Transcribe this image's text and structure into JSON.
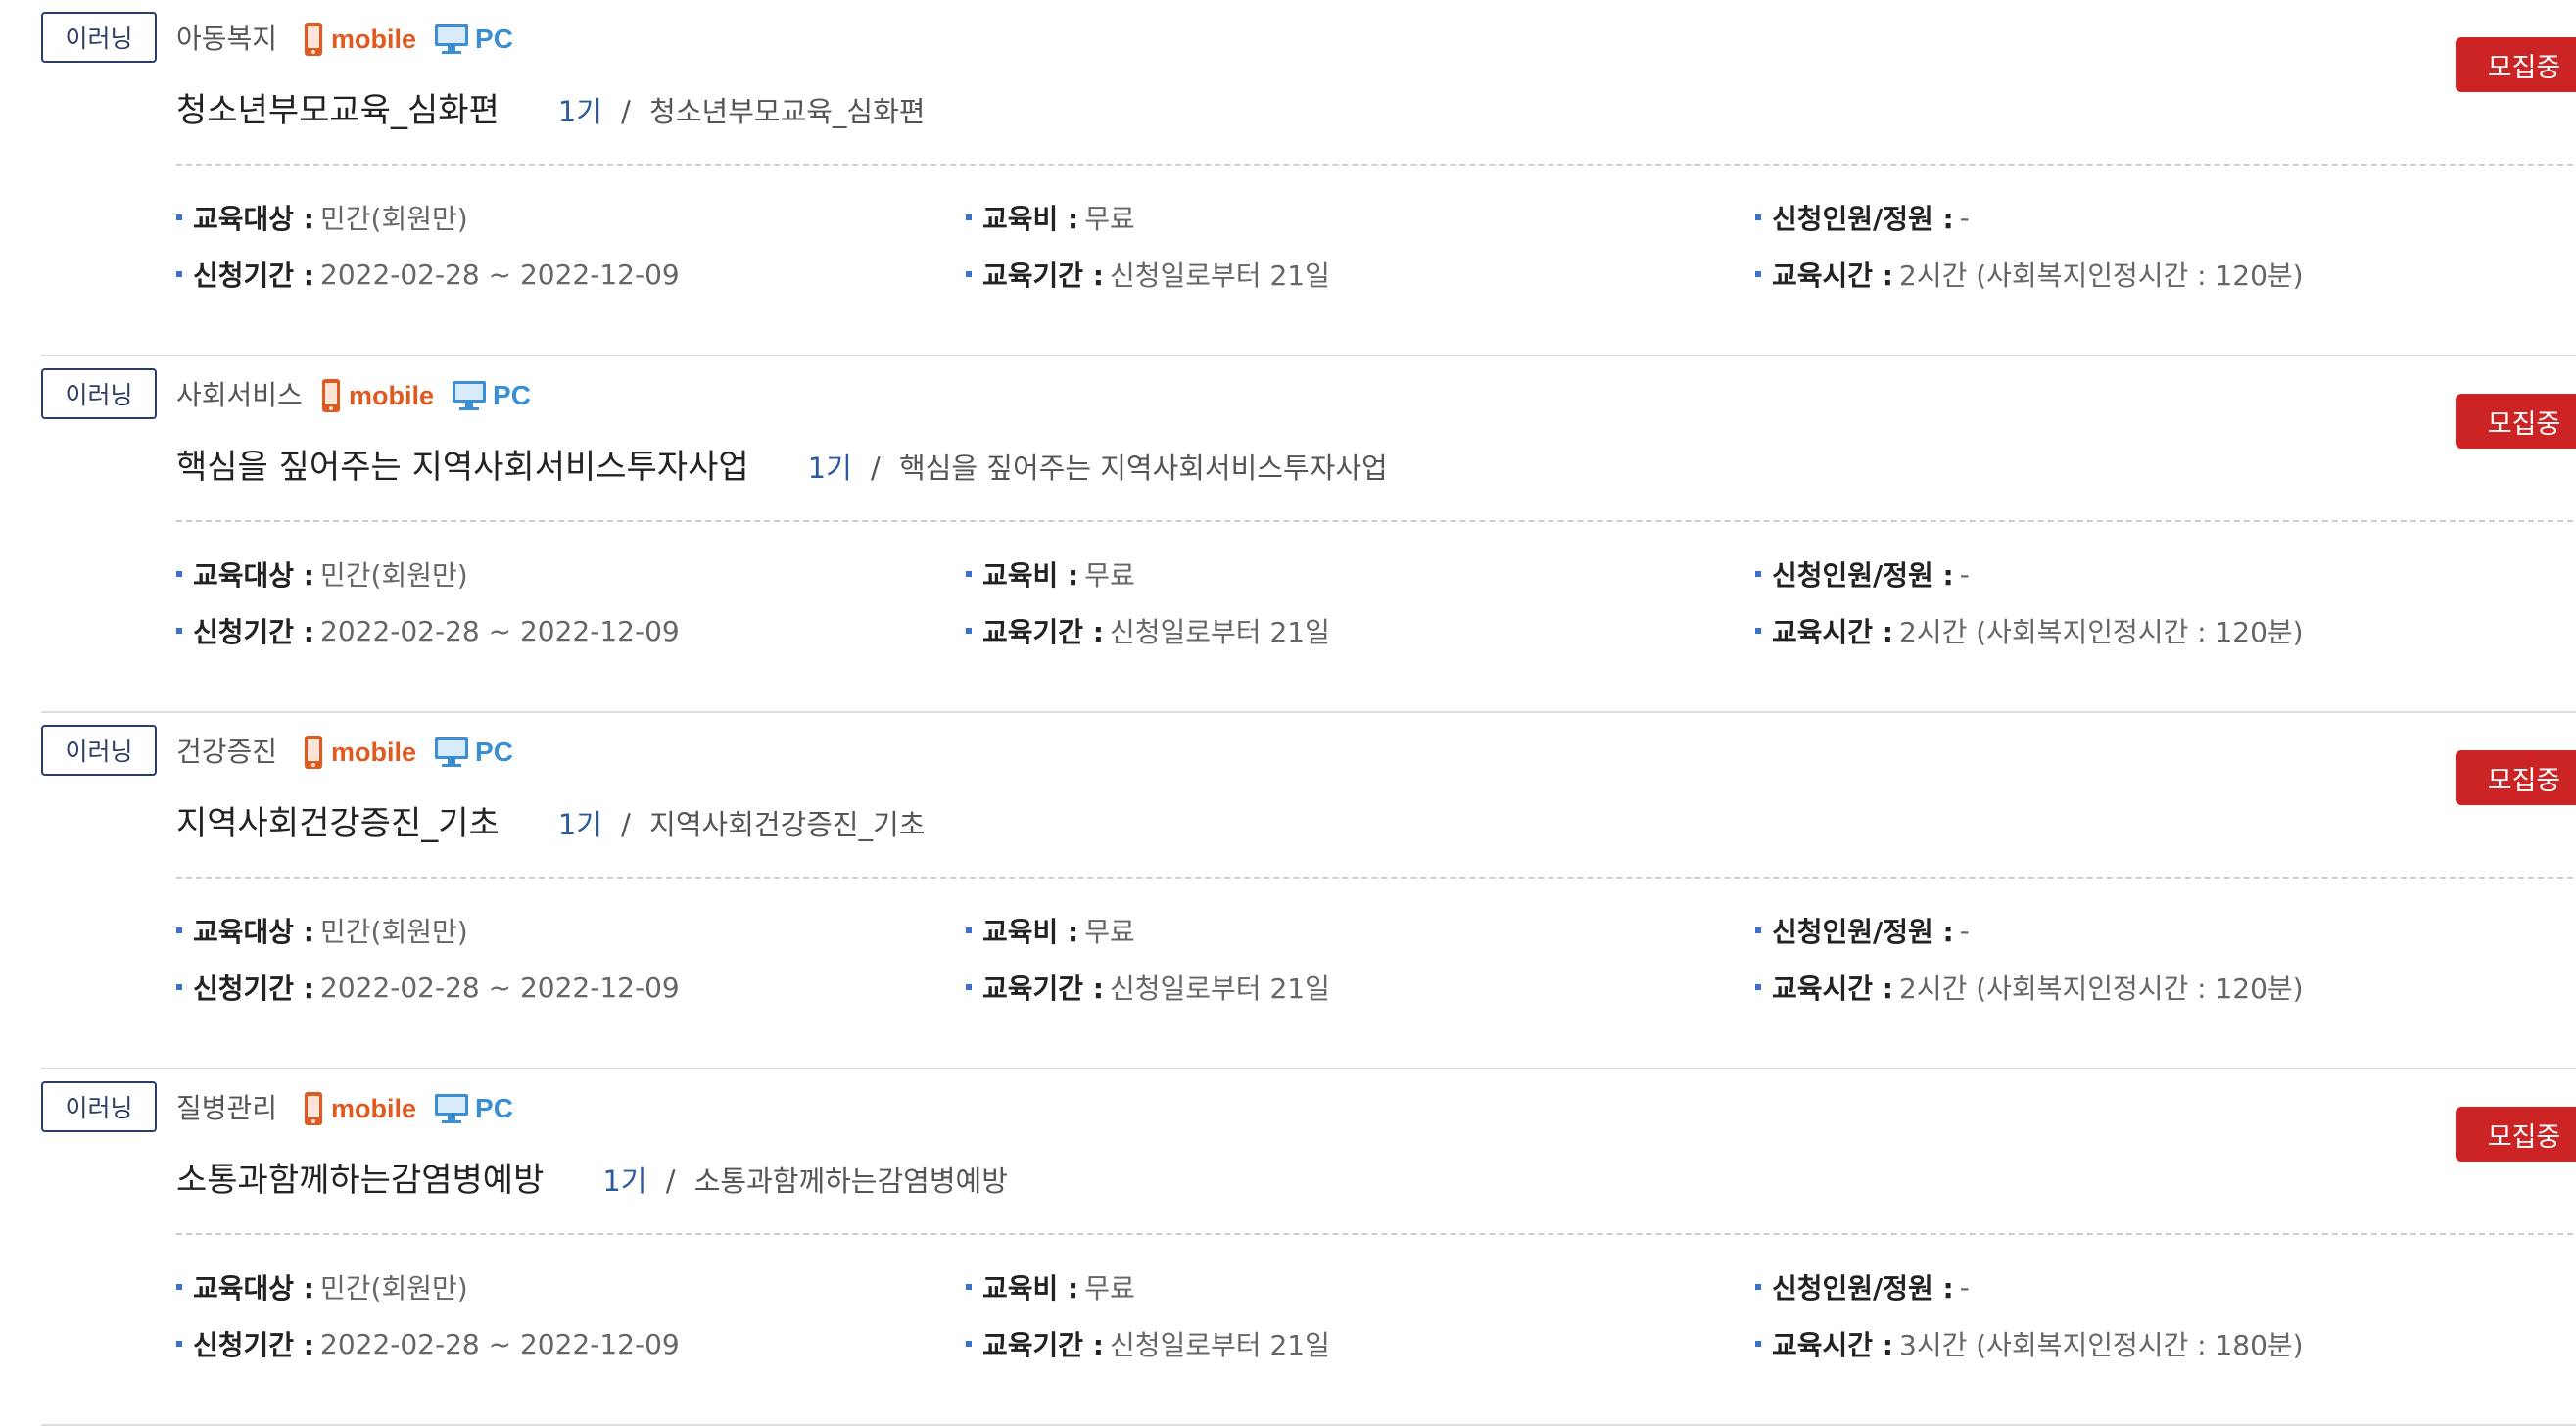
{
  "colors": {
    "navy": "#2c3e66",
    "status_red": "#cc2424",
    "mobile_orange": "#e05a1f",
    "pc_blue": "#3a8fd4",
    "bullet_blue": "#3b6fd1"
  },
  "labels": {
    "target": "교육대상 :",
    "fee": "교육비 :",
    "applicants": "신청인원/정원 :",
    "period": "신청기간 :",
    "duration": "교육기간 :",
    "hours": "교육시간 :",
    "mobile": "mobile",
    "pc": "PC",
    "slash": "/"
  },
  "icons": {
    "mobile": "mobile-phone-icon",
    "pc": "desktop-monitor-icon"
  },
  "courses": [
    {
      "type": "이러닝",
      "category": "아동복지",
      "title": "청소년부모교육_심화편",
      "term": "1기",
      "term_title": "청소년부모교육_심화편",
      "status": "모집중",
      "target": "민간(회원만)",
      "fee": "무료",
      "applicants": "-",
      "period": "2022-02-28 ~ 2022-12-09",
      "duration": "신청일로부터 21일",
      "hours": "2시간 (사회복지인정시간 : 120분)"
    },
    {
      "type": "이러닝",
      "category": "사회서비스",
      "title": "핵심을 짚어주는 지역사회서비스투자사업",
      "term": "1기",
      "term_title": "핵심을 짚어주는 지역사회서비스투자사업",
      "status": "모집중",
      "target": "민간(회원만)",
      "fee": "무료",
      "applicants": "-",
      "period": "2022-02-28 ~ 2022-12-09",
      "duration": "신청일로부터 21일",
      "hours": "2시간 (사회복지인정시간 : 120분)"
    },
    {
      "type": "이러닝",
      "category": "건강증진",
      "title": "지역사회건강증진_기초",
      "term": "1기",
      "term_title": "지역사회건강증진_기초",
      "status": "모집중",
      "target": "민간(회원만)",
      "fee": "무료",
      "applicants": "-",
      "period": "2022-02-28 ~ 2022-12-09",
      "duration": "신청일로부터 21일",
      "hours": "2시간 (사회복지인정시간 : 120분)"
    },
    {
      "type": "이러닝",
      "category": "질병관리",
      "title": "소통과함께하는감염병예방",
      "term": "1기",
      "term_title": "소통과함께하는감염병예방",
      "status": "모집중",
      "target": "민간(회원만)",
      "fee": "무료",
      "applicants": "-",
      "period": "2022-02-28 ~ 2022-12-09",
      "duration": "신청일로부터 21일",
      "hours": "3시간 (사회복지인정시간 : 180분)"
    }
  ]
}
